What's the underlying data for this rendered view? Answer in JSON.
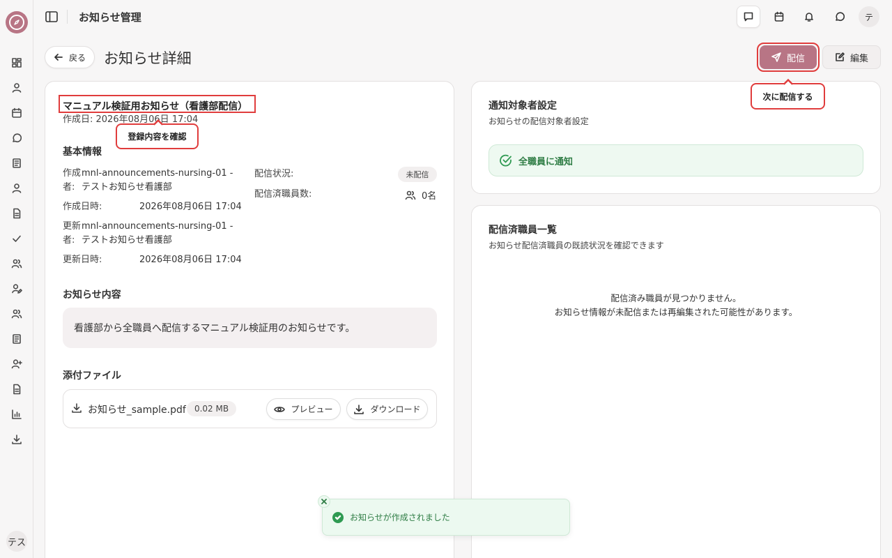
{
  "app": {
    "title": "お知らせ管理",
    "user_initials": "テス",
    "topbar_avatar": "テ"
  },
  "sidebar": {
    "items": [
      {
        "icon": "dashboard-icon"
      },
      {
        "icon": "user-icon"
      },
      {
        "icon": "calendar-icon"
      },
      {
        "icon": "chat-icon"
      },
      {
        "icon": "book-icon"
      },
      {
        "icon": "user-icon"
      },
      {
        "icon": "document-icon"
      },
      {
        "icon": "check-icon"
      },
      {
        "icon": "users-icon"
      },
      {
        "icon": "user-edit-icon"
      },
      {
        "icon": "users-icon"
      },
      {
        "icon": "book-icon"
      },
      {
        "icon": "user-add-icon"
      },
      {
        "icon": "document-icon"
      },
      {
        "icon": "bar-chart-icon"
      },
      {
        "icon": "download-icon"
      }
    ]
  },
  "header": {
    "back_label": "戻る",
    "page_title": "お知らせ詳細",
    "send_label": "配信",
    "edit_label": "編集"
  },
  "callouts": {
    "send_hint": "次に配信する",
    "title_hint": "登録内容を確認"
  },
  "announcement": {
    "title": "マニュアル検証用お知らせ（看護部配信）",
    "created": "作成日: 2026年08月06日 17:04"
  },
  "basic_info": {
    "heading": "基本情報",
    "creator_label_1": "作成",
    "creator_label_2": "者:",
    "creator_value_1": "mnl-announcements-nursing-01 -",
    "creator_value_2": "テストお知らせ看護部",
    "created_at_label": "作成日時:",
    "created_at_value": "2026年08月06日 17:04",
    "updater_label_1": "更新",
    "updater_label_2": "者:",
    "updater_value_1": "mnl-announcements-nursing-01 -",
    "updater_value_2": "テストお知らせ看護部",
    "updated_at_label": "更新日時:",
    "updated_at_value": "2026年08月06日 17:04",
    "status_label": "配信状況:",
    "status_value": "未配信",
    "delivered_count_label": "配信済職員数:",
    "delivered_count_value": "0名"
  },
  "content": {
    "heading": "お知らせ内容",
    "body": "看護部から全職員へ配信するマニュアル検証用のお知らせです。"
  },
  "attachments": {
    "heading": "添付ファイル",
    "file_name": "お知らせ_sample.pdf",
    "file_size": "0.02 MB",
    "preview_label": "プレビュー",
    "download_label": "ダウンロード"
  },
  "targets": {
    "heading": "通知対象者設定",
    "subtitle": "お知らせの配信対象者設定",
    "notify_all": "全職員に通知"
  },
  "delivered_list": {
    "heading": "配信済職員一覧",
    "subtitle": "お知らせ配信済職員の既読状況を確認できます",
    "empty_line1": "配信済み職員が見つかりません。",
    "empty_line2": "お知らせ情報が未配信または再編集された可能性があります。"
  },
  "toast": {
    "message": "お知らせが作成されました"
  },
  "colors": {
    "accent": "#b87585",
    "highlight": "#e03c3c",
    "success": "#2f9a52"
  }
}
